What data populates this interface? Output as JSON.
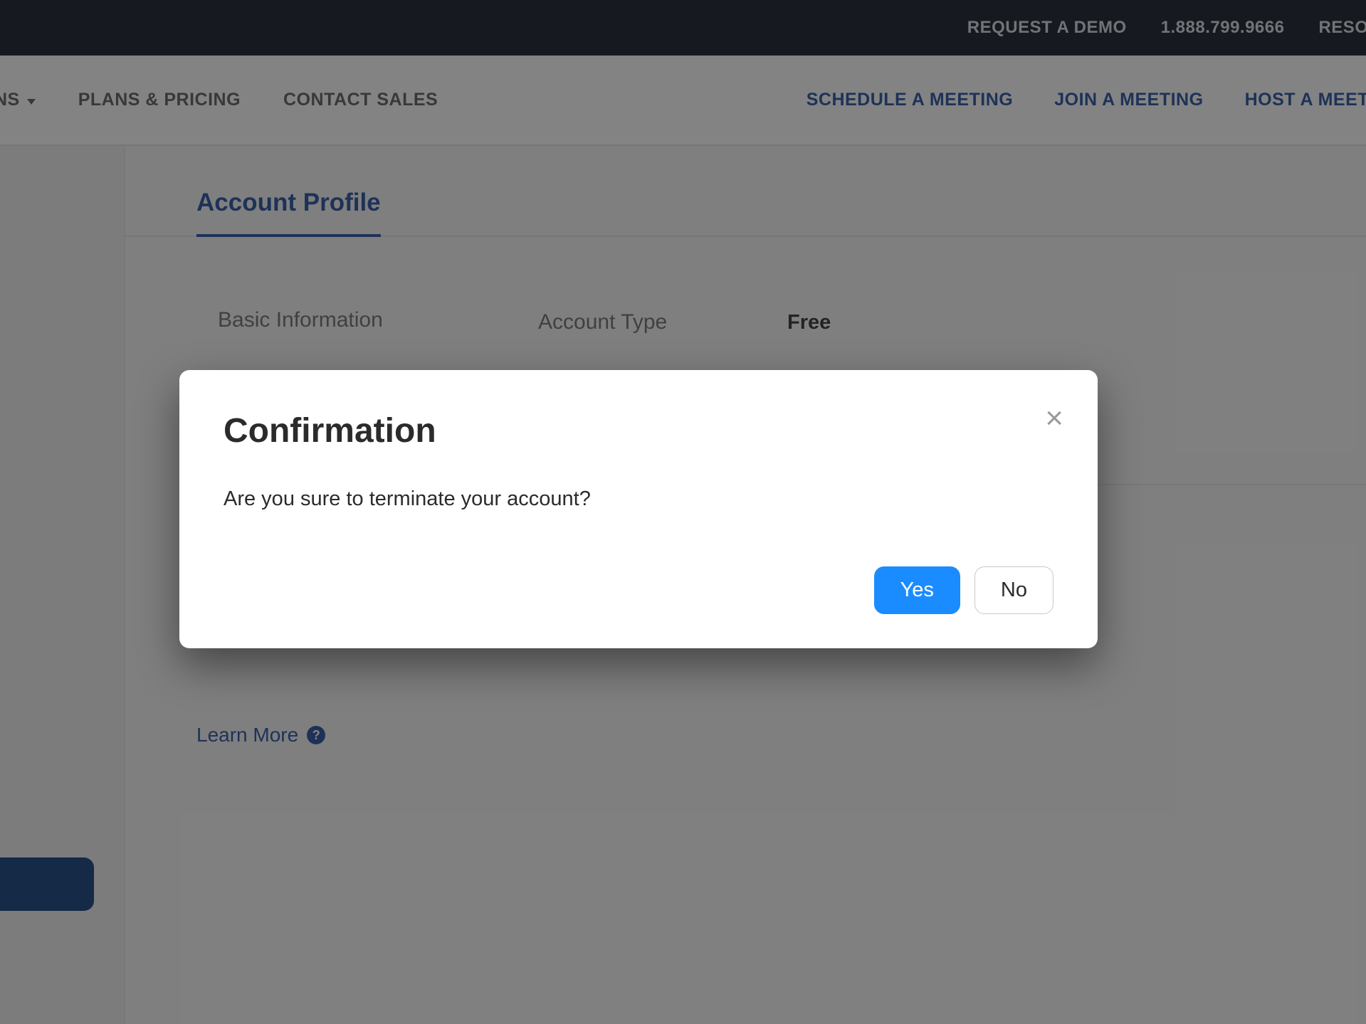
{
  "topbar": {
    "request_demo": "REQUEST A DEMO",
    "phone": "1.888.799.9666",
    "resources_partial": "RESOURCES"
  },
  "navbar": {
    "left": {
      "solutions_partial": "ONS",
      "plans": "PLANS & PRICING",
      "contact_sales": "CONTACT SALES"
    },
    "right": {
      "schedule": "SCHEDULE A MEETING",
      "join": "JOIN A MEETING",
      "host": "HOST A MEETING"
    }
  },
  "tabs": {
    "account_profile": "Account Profile"
  },
  "info": {
    "section_label": "Basic Information",
    "field_label": "Account Type",
    "field_value": "Free"
  },
  "learn_more": {
    "label": "Learn More",
    "help_glyph": "?"
  },
  "modal": {
    "title": "Confirmation",
    "body": "Are you sure to terminate your account?",
    "yes": "Yes",
    "no": "No",
    "close_glyph": "×"
  }
}
